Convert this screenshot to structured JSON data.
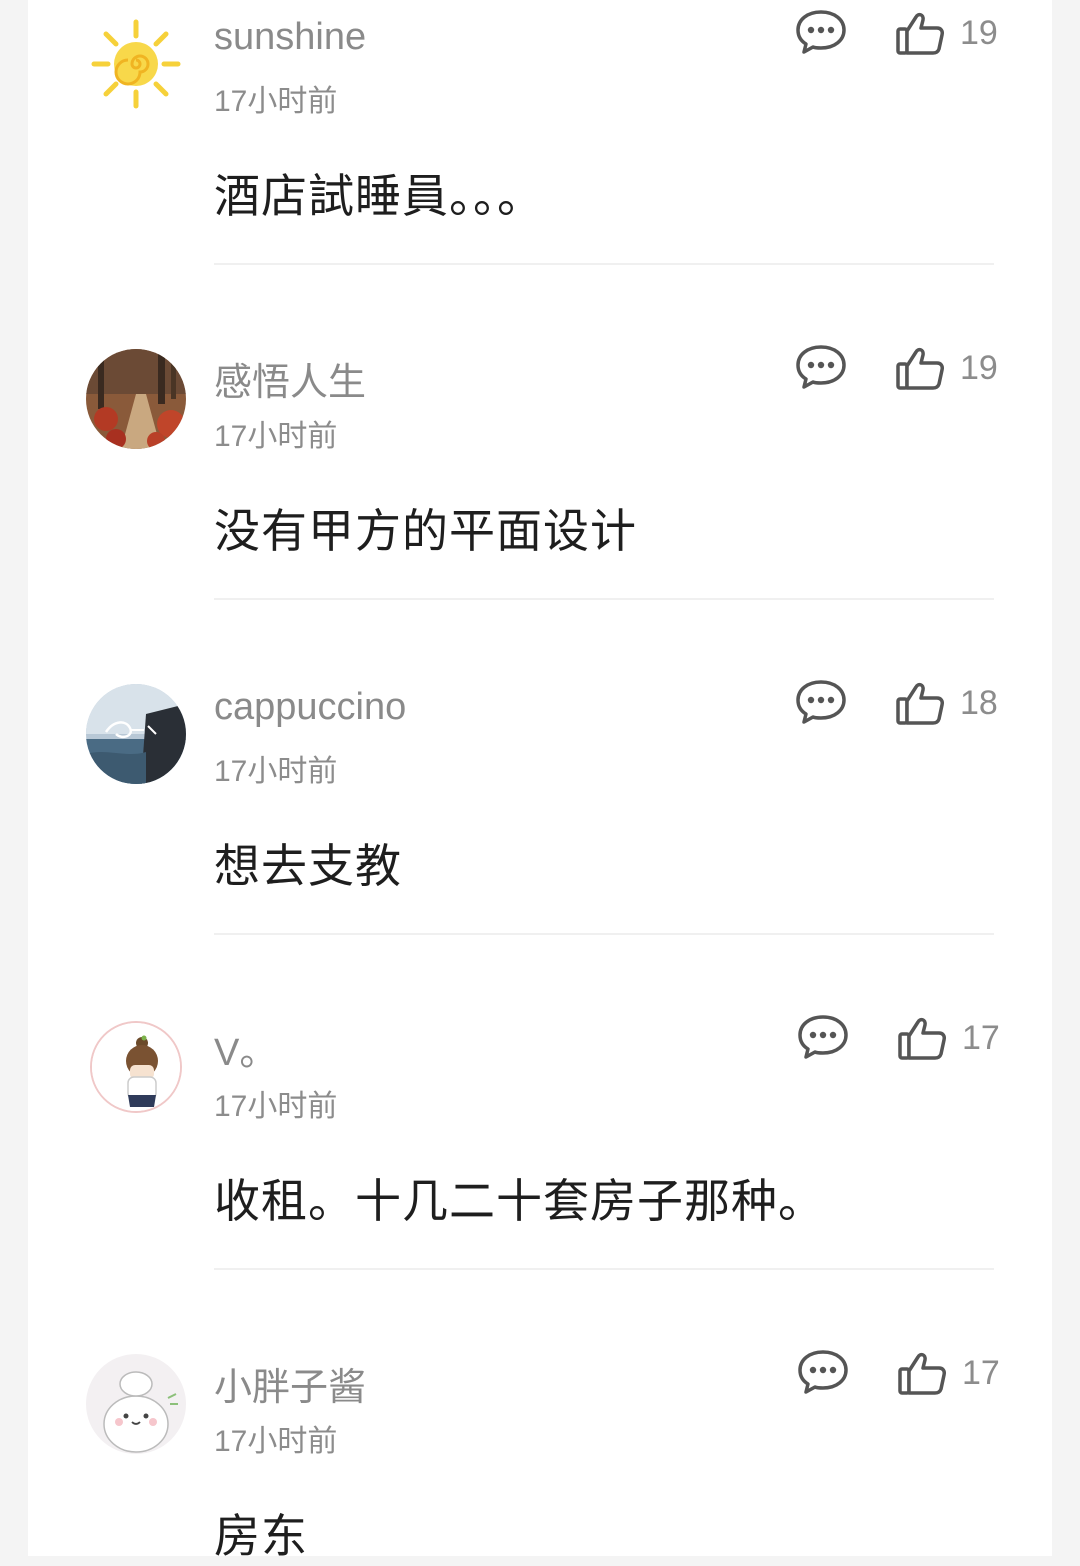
{
  "comments": [
    {
      "username": "sunshine",
      "time": "17小时前",
      "text": "酒店試睡員。。。",
      "likes": "19",
      "avatar": "sun-avatar"
    },
    {
      "username": "感悟人生",
      "time": "17小时前",
      "text": "没有甲方的平面设计",
      "likes": "19",
      "avatar": "autumn-path-avatar"
    },
    {
      "username": "cappuccino",
      "time": "17小时前",
      "text": "想去支教",
      "likes": "18",
      "avatar": "smile-seascape-avatar"
    },
    {
      "username": "V。",
      "time": "17小时前",
      "text": "收租。十几二十套房子那种。",
      "likes": "17",
      "avatar": "cartoon-girl-avatar"
    },
    {
      "username": "小胖子酱",
      "time": "17小时前",
      "text": "房东",
      "likes": "17",
      "avatar": "cartoon-bunny-avatar"
    }
  ],
  "icons": {
    "reply": "comment-bubble-icon",
    "like": "thumbs-up-icon"
  },
  "colors": {
    "username": "#8a8a8a",
    "meta": "#8c8c8c",
    "text": "#1e1e1e",
    "divider": "#f0f0f0"
  }
}
